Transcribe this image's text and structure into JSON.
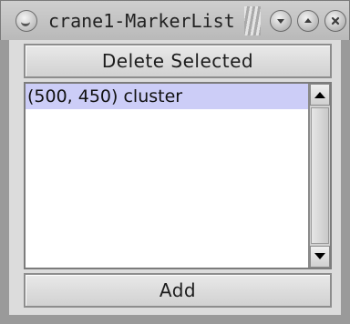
{
  "window": {
    "title": "crane1-MarkerList",
    "title_buttons": {
      "menu": "window-menu-icon",
      "minimize": "minimize-icon",
      "maximize": "maximize-icon",
      "close": "close-icon"
    }
  },
  "toolbar": {
    "delete_label": "Delete Selected",
    "add_label": "Add"
  },
  "marker_list": {
    "items": [
      {
        "label": "(500, 450) cluster",
        "selected": true
      }
    ],
    "selected_color": "#cccdf7"
  },
  "scrollbar": {
    "up_icon": "arrow-up-icon",
    "down_icon": "arrow-down-icon"
  }
}
